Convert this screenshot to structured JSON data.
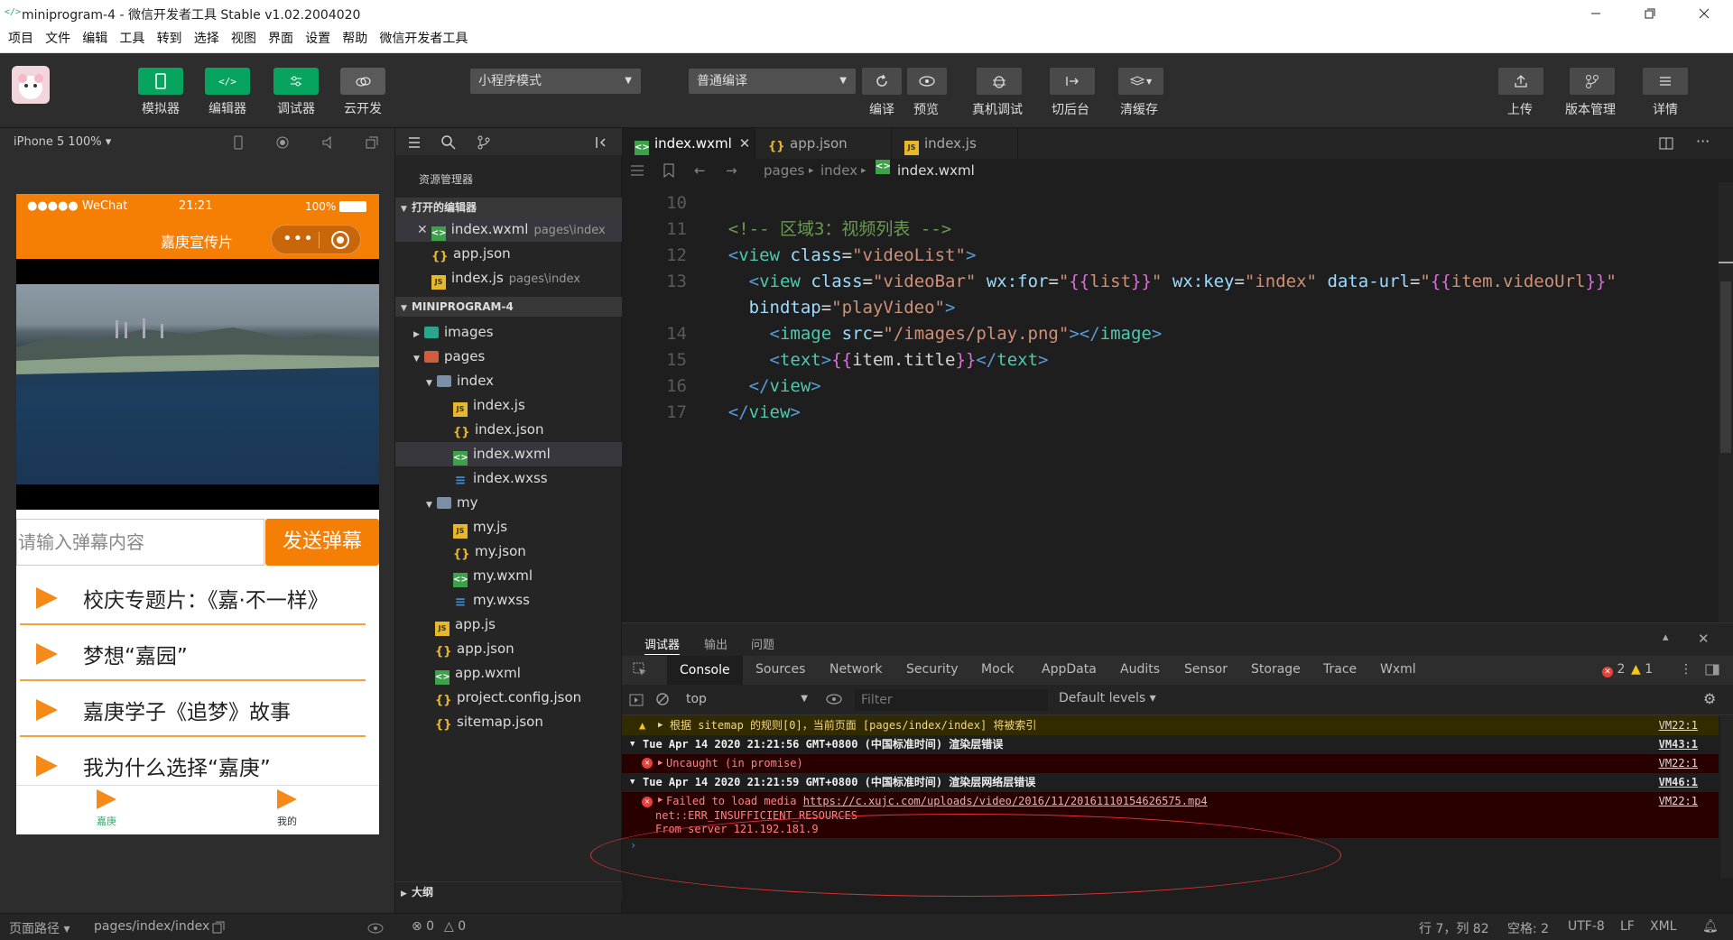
{
  "window": {
    "title": "miniprogram-4 - 微信开发者工具 Stable v1.02.2004020",
    "logo": "</>"
  },
  "menu": [
    "项目",
    "文件",
    "编辑",
    "工具",
    "转到",
    "选择",
    "视图",
    "界面",
    "设置",
    "帮助",
    "微信开发者工具"
  ],
  "toolbar": {
    "simulator": "模拟器",
    "editor": "编辑器",
    "debugger": "调试器",
    "cloud": "云开发",
    "mode": "小程序模式",
    "compile_mode": "普通编译",
    "compile": "编译",
    "preview": "预览",
    "real_debug": "真机调试",
    "background": "切后台",
    "clear_cache": "清缓存",
    "upload": "上传",
    "version": "版本管理",
    "details": "详情"
  },
  "simulator": {
    "device": "iPhone 5 100% ▾",
    "status_left": "●●●●● WeChat",
    "status_time": "21:21",
    "status_battery": "100%",
    "nav_title": "嘉庚宣传片",
    "danmu_placeholder": "请输入弹幕内容",
    "send_button": "发送弹幕",
    "videos": [
      "校庆专题片：《嘉·不一样》",
      "梦想“嘉园”",
      "嘉庚学子《追梦》故事",
      "我为什么选择“嘉庚”"
    ],
    "tabs": [
      "嘉庚",
      "我的"
    ]
  },
  "explorer": {
    "header": "资源管理器",
    "open_editors": "打开的编辑器",
    "open_files": [
      {
        "name": "index.wxml",
        "path": "pages\\index"
      },
      {
        "name": "app.json",
        "path": ""
      },
      {
        "name": "index.js",
        "path": "pages\\index"
      }
    ],
    "project": "MINIPROGRAM-4",
    "tree": [
      "images",
      "pages",
      "index",
      "index.js",
      "index.json",
      "index.wxml",
      "index.wxss",
      "my",
      "my.js",
      "my.json",
      "my.wxml",
      "my.wxss",
      "app.js",
      "app.json",
      "app.wxml",
      "project.config.json",
      "sitemap.json"
    ],
    "outline": "大纲"
  },
  "editor": {
    "tabs": [
      "index.wxml",
      "app.json",
      "index.js"
    ],
    "breadcrumb": [
      "pages",
      "index",
      "index.wxml"
    ],
    "line_numbers": [
      "10",
      "11",
      "12",
      "13",
      "",
      "14",
      "15",
      "16",
      "17"
    ]
  },
  "debugger": {
    "tabs": [
      "调试器",
      "输出",
      "问题"
    ],
    "tools": [
      "Console",
      "Sources",
      "Network",
      "Security",
      "Mock",
      "AppData",
      "Audits",
      "Sensor",
      "Storage",
      "Trace",
      "Wxml"
    ],
    "errors": "2",
    "warnings": "1",
    "context": "top",
    "filter_placeholder": "Filter",
    "levels": "Default levels ▾",
    "logs": {
      "warn": "根据 sitemap 的规则[0]，当前页面 [pages/index/index] 将被索引",
      "warn_src": "VM22:1",
      "group1": "Tue Apr 14 2020 21:21:56 GMT+0800 (中国标准时间) 渲染层错误",
      "group1_src": "VM43:1",
      "err1": "Uncaught (in promise)",
      "err1_src": "VM22:1",
      "group2": "Tue Apr 14 2020 21:21:59 GMT+0800 (中国标准时间) 渲染层网络层错误",
      "group2_src": "VM46:1",
      "err2_prefix": "Failed to load media ",
      "err2_url": "https://c.xujc.com/uploads/video/2016/11/20161110154626575.mp4",
      "err2_line2": "net::ERR_INSUFFICIENT_RESOURCES",
      "err2_line3": "From server 121.192.181.9",
      "err2_src": "VM22:1"
    }
  },
  "footer": {
    "page_path_label": "页面路径 ▾",
    "page_path": "pages/index/index",
    "errors": "⊗ 0",
    "warnings": "△ 0",
    "cursor": "行 7，列 82",
    "spaces": "空格: 2",
    "encoding": "UTF-8",
    "eol": "LF",
    "language": "XML"
  }
}
